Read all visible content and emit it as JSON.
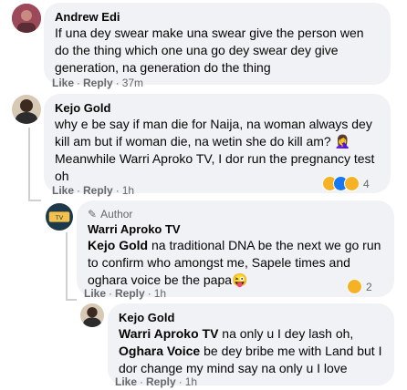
{
  "comments": [
    {
      "author": "Andrew Edi",
      "text": "If una dey swear make una swear give the person wen do the thing which one una go dey swear dey give generation, na generation do the thing",
      "like": "Like",
      "reply": "Reply",
      "time": "37m"
    },
    {
      "author": "Kejo Gold",
      "text": "why e be say if man die for Naija, na woman always dey kill am but if woman die, na wetin she do kill am? 🤦‍♀️ Meanwhile Warri Aproko TV, I dor run the pregnancy test oh",
      "like": "Like",
      "reply": "Reply",
      "time": "1h",
      "reaction_count": "4",
      "reaction_icons": [
        "haha-icon",
        "like-icon",
        "wow-icon"
      ]
    },
    {
      "author_badge": "Author",
      "author": "Warri Aproko TV",
      "mention": "Kejo Gold",
      "text": " na traditional DNA be the next we go run to confirm who amongst me, Sapele times and oghara voice be the papa😜",
      "like": "Like",
      "reply": "Reply",
      "time": "1h",
      "reaction_count": "2",
      "reaction_icons": [
        "haha-icon"
      ]
    },
    {
      "author": "Kejo Gold",
      "mention1": "Warri Aproko TV",
      "text1": " na only u I dey lash oh,",
      "mention2": "Oghara Voice",
      "text2": " be dey bribe me with Land but I dor change my mind say na only u I love",
      "like": "Like",
      "reply": "Reply",
      "time": "1h"
    }
  ],
  "colors": {
    "bubble": "#f0f2f5",
    "meta": "#65676b",
    "text": "#050505",
    "like_blue": "#1877f2",
    "haha_yellow": "#f7b125"
  }
}
